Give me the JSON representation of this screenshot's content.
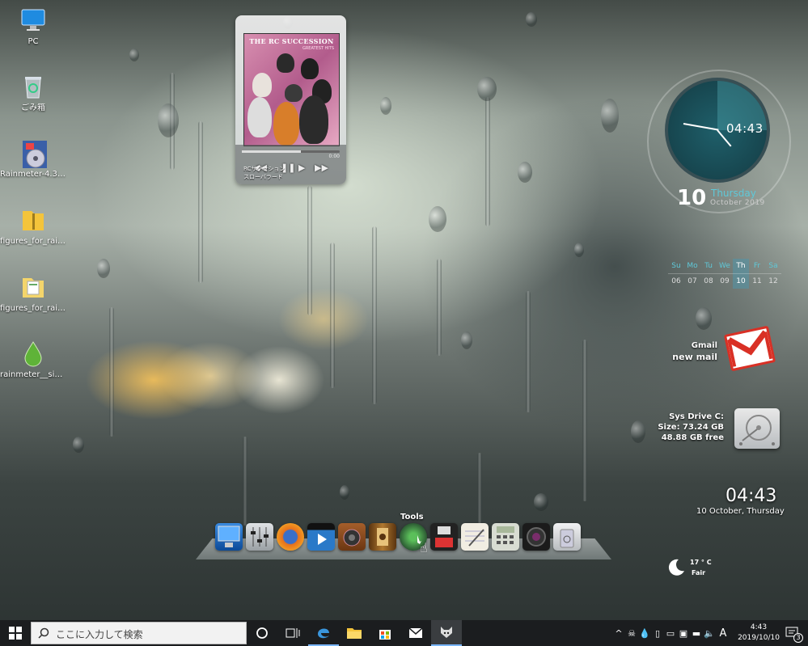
{
  "desktop": {
    "icons": [
      {
        "label": "PC"
      },
      {
        "label": "ごみ箱"
      },
      {
        "label": "Rainmeter-4.3.1...."
      },
      {
        "label": "figures_for_rainm..."
      },
      {
        "label": "figures_for_rainm..."
      },
      {
        "label": "rainmeter__simpl..."
      }
    ]
  },
  "player": {
    "album_title": "THE RC SUCCESSION",
    "album_sub": "GREATEST HITS",
    "track_line1": "RCサクセション",
    "track_line2": "スローバラード",
    "time": "0:00",
    "prev": "◀◀",
    "playpause": "❚❚ ▶",
    "next": "▶▶"
  },
  "clock": {
    "time": "04:43",
    "day_number": "10",
    "weekday": "Thursday",
    "month_year": "October 2019"
  },
  "calendar": {
    "headers": [
      "Su",
      "Mo",
      "Tu",
      "We",
      "Th",
      "Fr",
      "Sa"
    ],
    "days": [
      "06",
      "07",
      "08",
      "09",
      "10",
      "11",
      "12"
    ],
    "today_index": 4
  },
  "gmail": {
    "title": "Gmail",
    "status": "new mail"
  },
  "drive": {
    "name": "Sys Drive C:",
    "size": "Size: 73.24 GB",
    "free": "48.88 GB free"
  },
  "digital_clock": {
    "time": "04:43",
    "date": "10 October, Thursday"
  },
  "weather": {
    "temp": "17 ° C",
    "condition": "Fair",
    "icon": "moon-icon"
  },
  "dock": {
    "hover_label": "Tools",
    "items": [
      {
        "name": "computer-icon",
        "color": "#1b6fc2"
      },
      {
        "name": "mixer-icon",
        "color": "#9aa0a4"
      },
      {
        "name": "firefox-icon",
        "color": "#e8711c"
      },
      {
        "name": "video-icon",
        "color": "#2a5f9a"
      },
      {
        "name": "speaker-icon",
        "color": "#8a4b22"
      },
      {
        "name": "film-icon",
        "color": "#7a4a1a"
      },
      {
        "name": "tools-icon",
        "color": "#4f7d55"
      },
      {
        "name": "floppy-icon",
        "color": "#303030"
      },
      {
        "name": "notepad-icon",
        "color": "#e8e4d8"
      },
      {
        "name": "calculator-icon",
        "color": "#c9cdc3"
      },
      {
        "name": "camera-icon",
        "color": "#1e1e1e"
      },
      {
        "name": "recycle-icon",
        "color": "#d4d6d8"
      }
    ]
  },
  "taskbar": {
    "search_placeholder": "ここに入力して検索",
    "tray_time": "4:43",
    "tray_date": "2019/10/10",
    "ime": "A",
    "notification_count": "3"
  }
}
